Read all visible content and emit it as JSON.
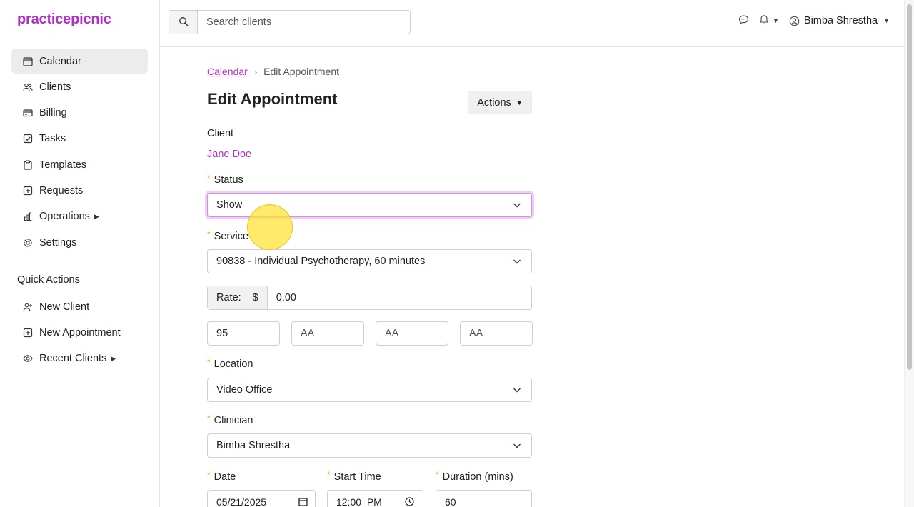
{
  "brand": {
    "logo": "practicepicnic",
    "accent_color": "#b22fc5"
  },
  "sidebar": {
    "items": [
      {
        "label": "Calendar",
        "icon": "calendar-icon",
        "active": true
      },
      {
        "label": "Clients",
        "icon": "users-icon"
      },
      {
        "label": "Billing",
        "icon": "credit-card-icon"
      },
      {
        "label": "Tasks",
        "icon": "checkbox-icon"
      },
      {
        "label": "Templates",
        "icon": "clipboard-icon"
      },
      {
        "label": "Requests",
        "icon": "plus-square-icon"
      },
      {
        "label": "Operations",
        "icon": "bar-chart-icon",
        "has_submenu": true
      },
      {
        "label": "Settings",
        "icon": "gear-icon"
      }
    ],
    "quick_actions_heading": "Quick Actions",
    "quick_actions": [
      {
        "label": "New Client",
        "icon": "person-plus-icon"
      },
      {
        "label": "New Appointment",
        "icon": "calendar-plus-icon"
      },
      {
        "label": "Recent Clients",
        "icon": "eye-icon",
        "has_submenu": true
      }
    ]
  },
  "header": {
    "search_placeholder": "Search clients",
    "user_name": "Bimba Shrestha"
  },
  "main": {
    "breadcrumb": {
      "parent": "Calendar",
      "separator": "›",
      "current": "Edit Appointment"
    },
    "title": "Edit Appointment",
    "actions_label": "Actions",
    "client_label": "Client",
    "client_name": "Jane Doe",
    "status_label": "Status",
    "status_value": "Show",
    "service_label": "Service",
    "service_value": "90838 - Individual Psychotherapy, 60 minutes",
    "rate_label": "Rate:",
    "rate_currency": "$",
    "rate_value": "0.00",
    "modifiers": [
      "95",
      "AA",
      "AA",
      "AA"
    ],
    "location_label": "Location",
    "location_value": "Video Office",
    "clinician_label": "Clinician",
    "clinician_value": "Bimba Shrestha",
    "date_label": "Date",
    "date_value": "05/21/2025",
    "start_time_label": "Start Time",
    "start_time_value": "12:00  PM",
    "duration_label": "Duration (mins)",
    "duration_value": "60",
    "required_marker": "*",
    "required_color": "#f5a700"
  }
}
